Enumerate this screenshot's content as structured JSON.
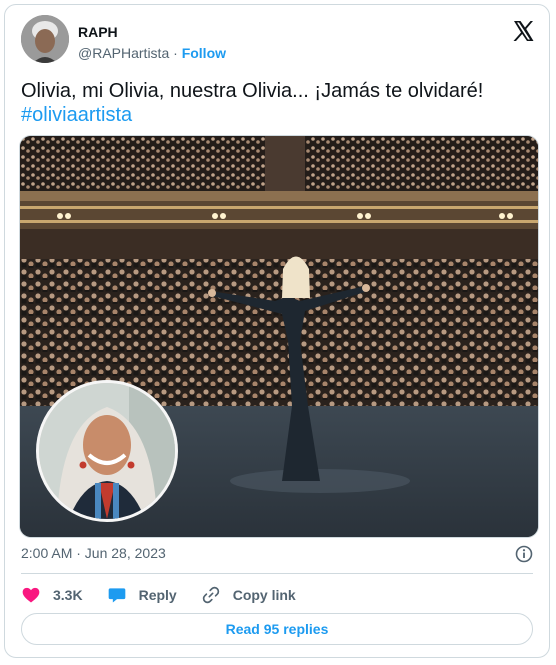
{
  "author": {
    "name": "RAPH",
    "handle": "@RAPHartista",
    "separator": "·",
    "follow_label": "Follow"
  },
  "post": {
    "text": "Olivia, mi Olivia, nuestra Olivia... ¡Jamás te olvidaré!",
    "hashtag": "#oliviaartista",
    "timestamp": "2:00 AM · Jun 28, 2023"
  },
  "actions": {
    "likes": "3.3K",
    "reply_label": "Reply",
    "copy_link_label": "Copy link",
    "read_replies_label": "Read 95 replies"
  },
  "colors": {
    "accent": "#1d9bf0",
    "like": "#f91880",
    "muted": "#536471",
    "border": "#cfd9de"
  },
  "icons": [
    "x-logo-icon",
    "heart-icon",
    "reply-bubble-icon",
    "link-icon",
    "info-icon"
  ]
}
